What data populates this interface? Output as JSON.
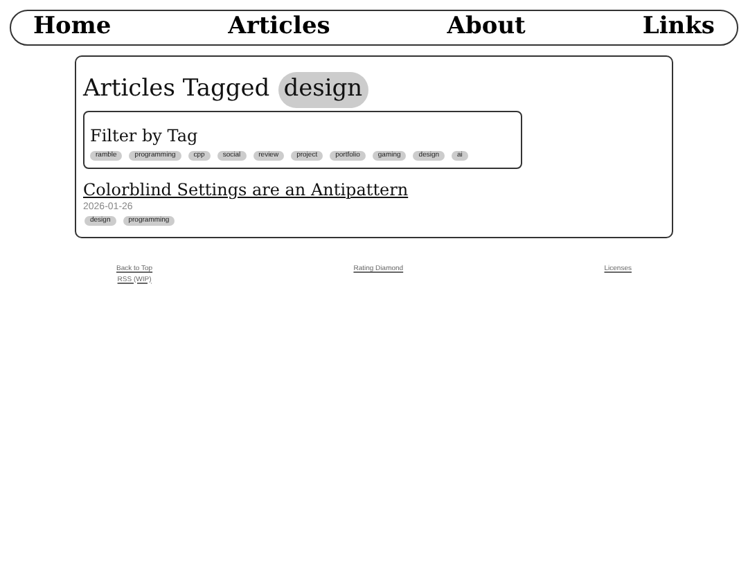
{
  "nav": [
    "Home",
    "Articles",
    "About",
    "Links"
  ],
  "heading": {
    "text": "Articles Tagged",
    "tag": "design"
  },
  "filter": {
    "title": "Filter by Tag",
    "tags": [
      "ramble",
      "programming",
      "cpp",
      "social",
      "review",
      "project",
      "portfolio",
      "gaming",
      "design",
      "ai"
    ]
  },
  "articles": [
    {
      "title": "Colorblind Settings are an Antipattern",
      "date": "2026-01-26",
      "tags": [
        "design",
        "programming"
      ]
    }
  ],
  "footer": {
    "left": [
      "Back to Top",
      "RSS (WIP)"
    ],
    "center": "Rating Diamond",
    "right": "Licenses"
  }
}
